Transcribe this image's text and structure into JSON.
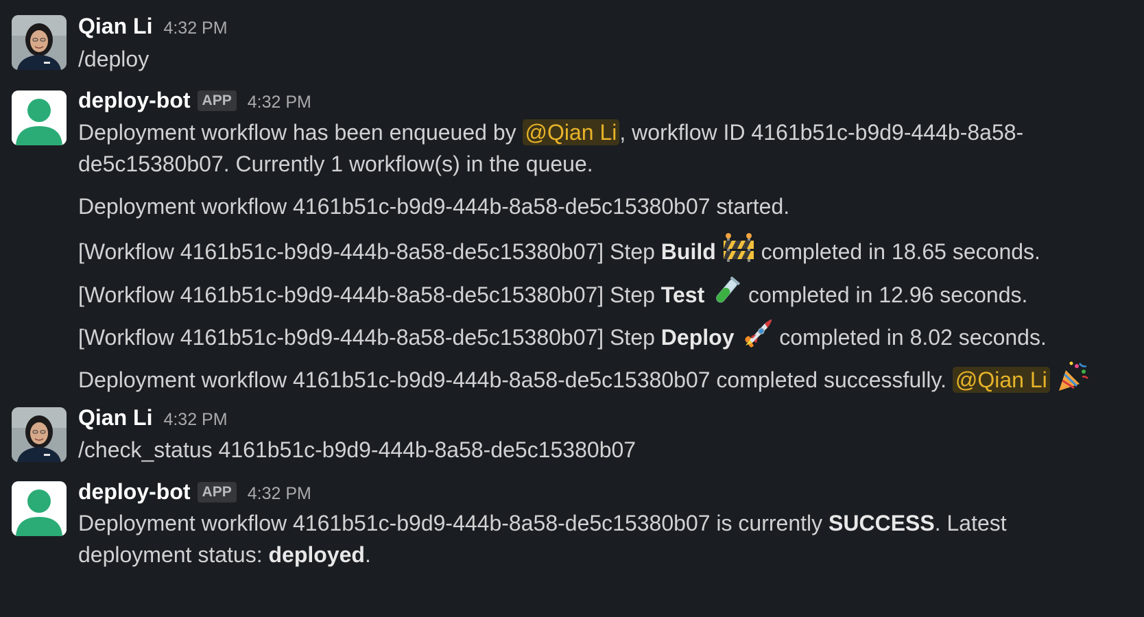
{
  "messages": [
    {
      "sender": "Qian Li",
      "time": "4:32 PM",
      "avatar_icon": "user-photo-avatar-icon",
      "text": "/deploy"
    },
    {
      "sender": "deploy-bot",
      "badge": "APP",
      "time": "4:32 PM",
      "avatar_icon": "default-user-avatar-icon",
      "enqueue": {
        "prefix": "Deployment workflow has been enqueued by ",
        "mention": "@Qian Li",
        "suffix": ", workflow ID 4161b51c-b9d9-444b-8a58-",
        "line2": "de5c15380b07. Currently 1 workflow(s) in the queue."
      },
      "started": "Deployment workflow 4161b51c-b9d9-444b-8a58-de5c15380b07 started.",
      "steps": [
        {
          "prefix": "[Workflow 4161b51c-b9d9-444b-8a58-de5c15380b07] Step ",
          "name": "Build",
          "icon": "construction-barrier-icon",
          "suffix": " completed in 18.65 seconds."
        },
        {
          "prefix": "[Workflow 4161b51c-b9d9-444b-8a58-de5c15380b07] Step ",
          "name": "Test",
          "icon": "test-tube-icon",
          "suffix": " completed in 12.96 seconds."
        },
        {
          "prefix": "[Workflow 4161b51c-b9d9-444b-8a58-de5c15380b07] Step ",
          "name": "Deploy",
          "icon": "rocket-icon",
          "suffix": " completed in 8.02 seconds."
        }
      ],
      "completed": {
        "text": "Deployment workflow 4161b51c-b9d9-444b-8a58-de5c15380b07 completed successfully. ",
        "mention": "@Qian Li",
        "icon": "party-popper-icon"
      }
    },
    {
      "sender": "Qian Li",
      "time": "4:32 PM",
      "avatar_icon": "user-photo-avatar-icon",
      "text": "/check_status 4161b51c-b9d9-444b-8a58-de5c15380b07"
    },
    {
      "sender": "deploy-bot",
      "badge": "APP",
      "time": "4:32 PM",
      "avatar_icon": "default-user-avatar-icon",
      "status": {
        "prefix": "Deployment workflow 4161b51c-b9d9-444b-8a58-de5c15380b07 is currently ",
        "state": "SUCCESS",
        "suffix": ". Latest",
        "line2_prefix": "deployment status: ",
        "deployment_status": "deployed",
        "line2_suffix": "."
      }
    }
  ],
  "colors": {
    "background": "#1a1d21",
    "text": "#d1d2d3",
    "mention_text": "#e8b429",
    "mention_bg": "#3d3418",
    "bot_avatar_green": "#2bac76"
  }
}
